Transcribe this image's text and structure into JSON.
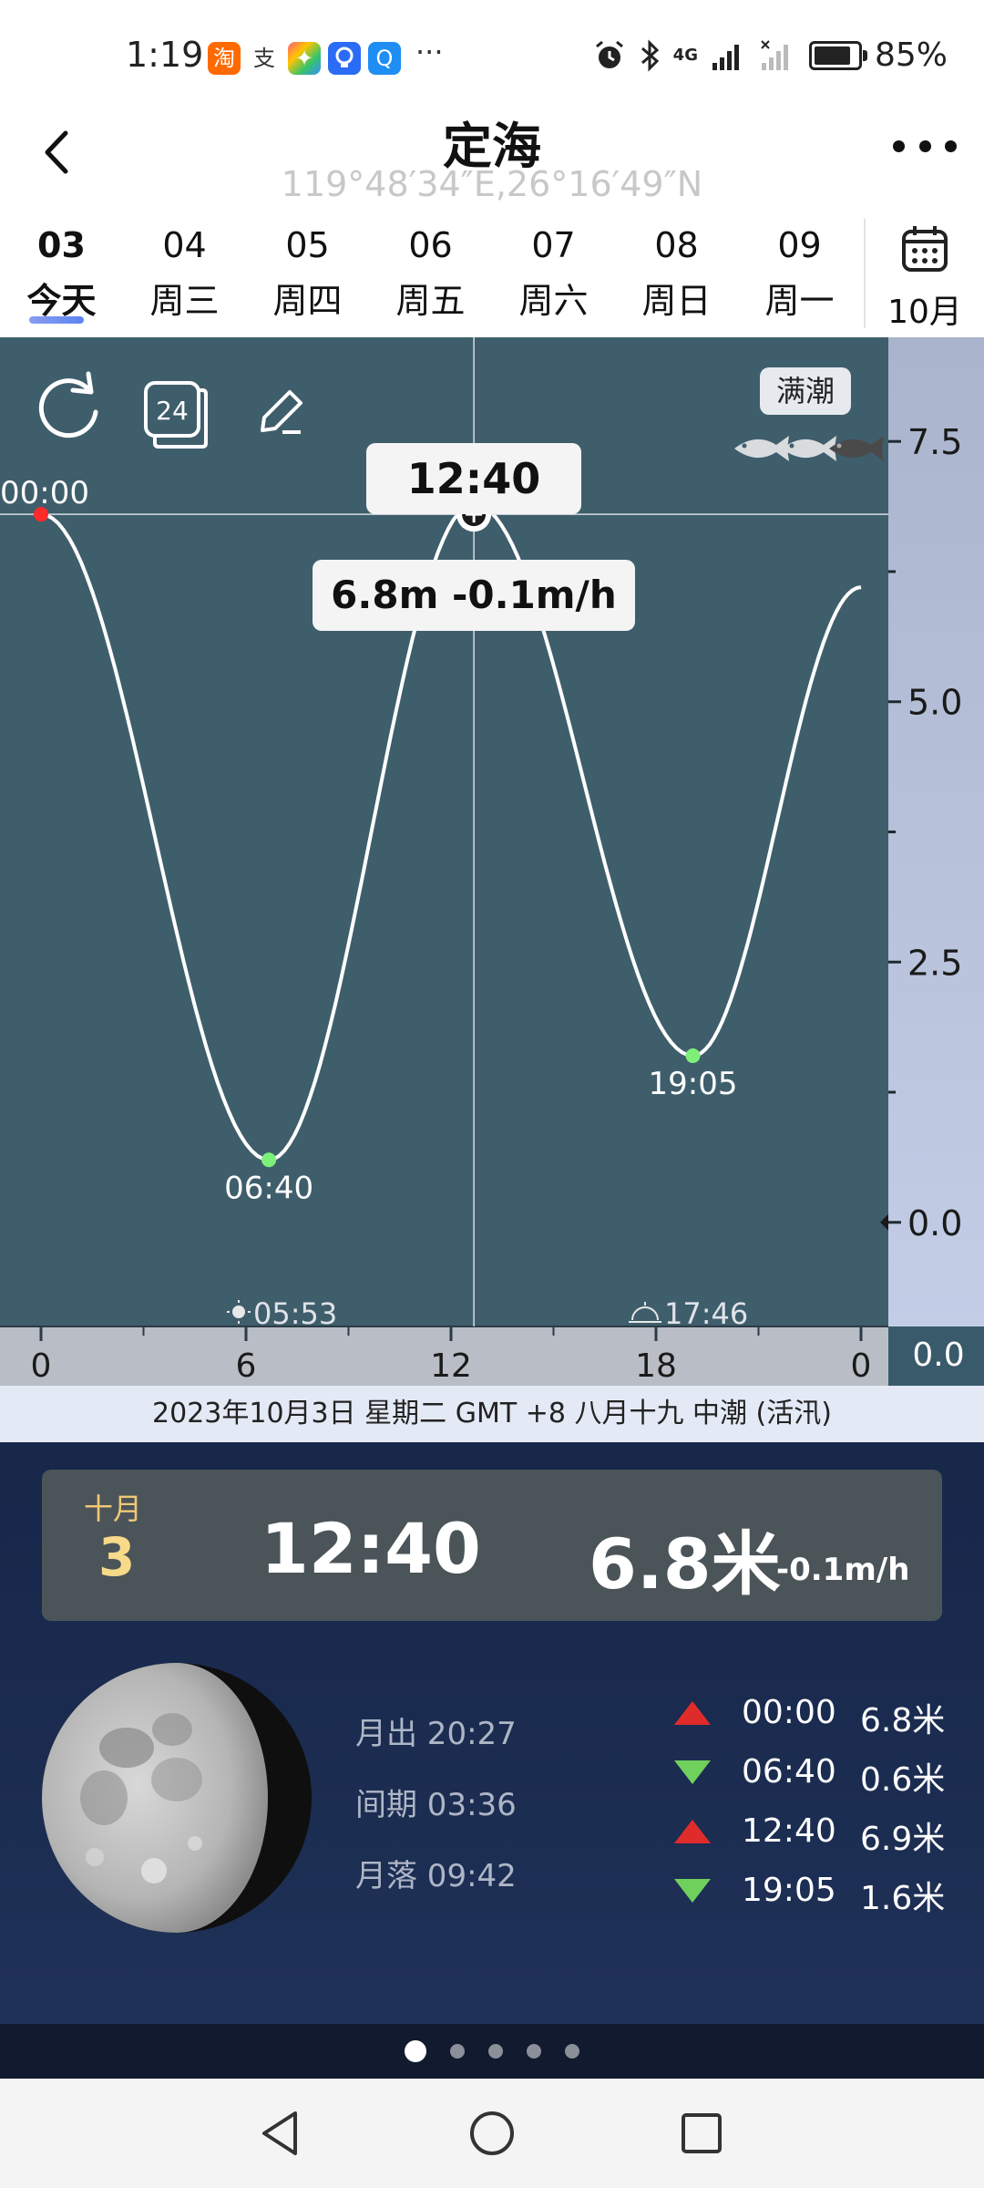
{
  "status_bar": {
    "time": "1:19",
    "apps": [
      {
        "name": "taobao",
        "label": "淘",
        "color": "#ff6a00"
      },
      {
        "name": "alipay",
        "label": "支",
        "color": "#ffffff"
      },
      {
        "name": "app-colorful",
        "label": "✦",
        "color": "#ffb400"
      },
      {
        "name": "app-bulb",
        "label": "💡",
        "color": "#2a6cf5"
      },
      {
        "name": "app-search",
        "label": "Q",
        "color": "#1e8ef5"
      }
    ],
    "more": "···",
    "battery": "85%",
    "battery_level": 0.85,
    "network": "4G"
  },
  "header": {
    "title": "定海",
    "subtitle": "119°48′34″E,26°16′49″N"
  },
  "date_tabs": [
    {
      "num": "03",
      "day": "今天",
      "active": true
    },
    {
      "num": "04",
      "day": "周三"
    },
    {
      "num": "05",
      "day": "周四"
    },
    {
      "num": "06",
      "day": "周五"
    },
    {
      "num": "07",
      "day": "周六"
    },
    {
      "num": "08",
      "day": "周日"
    },
    {
      "num": "09",
      "day": "周一"
    }
  ],
  "calendar": {
    "month": "10月"
  },
  "chart": {
    "badge": "满潮",
    "tooltip_time": "12:40",
    "tooltip_value": "6.8m  -0.1m/h",
    "sunrise": "05:53",
    "sunset": "17:46",
    "right_bottom_value": "0.0"
  },
  "chart_data": {
    "type": "line",
    "x_ticks": [
      "0",
      "6",
      "12",
      "18",
      "0"
    ],
    "y_ticks": [
      "7.5",
      "5.0",
      "2.5",
      "0.0"
    ],
    "ylim": [
      -1.0,
      8.5
    ],
    "xlim": [
      0,
      24
    ],
    "series": [
      {
        "points": [
          [
            0,
            6.8
          ],
          [
            6.67,
            0.6
          ],
          [
            12.67,
            6.9
          ],
          [
            19.08,
            1.6
          ],
          [
            24,
            6.1
          ]
        ]
      }
    ],
    "extrema_labels": [
      {
        "label": "00:00",
        "x": 0,
        "y": 6.8,
        "color": "#ff2a2a"
      },
      {
        "label": "06:40",
        "x": 6.67,
        "y": 0.6,
        "color": "#7ef07a"
      },
      {
        "label": "19:05",
        "x": 19.08,
        "y": 1.6,
        "color": "#7ef07a"
      }
    ],
    "cursor": {
      "x": 12.67,
      "y": 6.8,
      "label": "12:40"
    }
  },
  "info_bar": "2023年10月3日  星期二  GMT +8  八月十九  中潮 (活汛)",
  "current": {
    "month": "十月",
    "day": "3",
    "time": "12:40",
    "height": "6.8米",
    "rate": "-0.1m/h"
  },
  "moon": {
    "rise": "月出 20:27",
    "period": "间期 03:36",
    "set": "月落 09:42"
  },
  "tides": [
    {
      "dir": "up",
      "time": "00:00",
      "height": "6.8米"
    },
    {
      "dir": "down",
      "time": "06:40",
      "height": "0.6米"
    },
    {
      "dir": "up",
      "time": "12:40",
      "height": "6.9米"
    },
    {
      "dir": "down",
      "time": "19:05",
      "height": "1.6米"
    }
  ]
}
